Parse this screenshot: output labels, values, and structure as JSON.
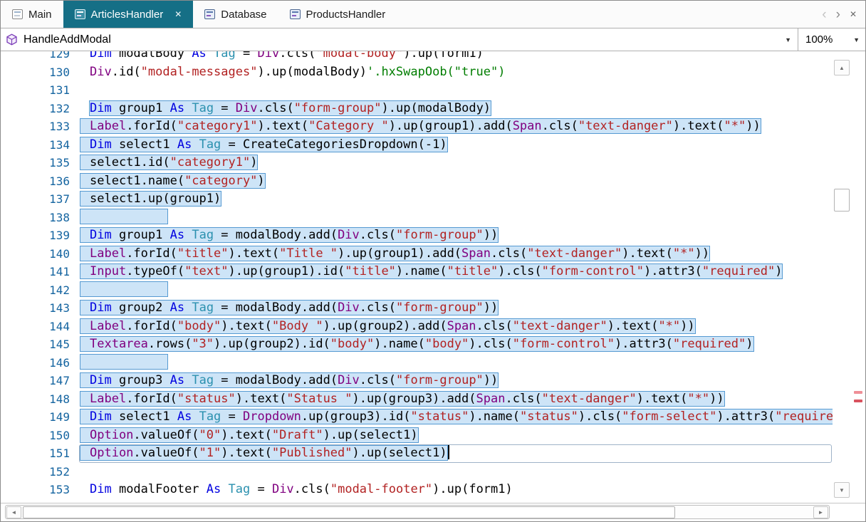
{
  "tabbar": {
    "tabs": [
      {
        "label": "Main",
        "icon": "form-module-icon",
        "active": false,
        "closable": false
      },
      {
        "label": "ArticlesHandler",
        "icon": "code-module-icon",
        "active": true,
        "closable": true
      },
      {
        "label": "Database",
        "icon": "code-module-icon",
        "active": false,
        "closable": false
      },
      {
        "label": "ProductsHandler",
        "icon": "code-module-icon",
        "active": false,
        "closable": false
      }
    ]
  },
  "navigator": {
    "selected_sub": "HandleAddModal",
    "zoom": "100%"
  },
  "icons": {
    "dropdown": "▼",
    "tab_back": "‹",
    "tab_forward": "›",
    "tab_close": "✕",
    "scroll_up": "▲",
    "scroll_down": "▼",
    "scroll_left": "◄",
    "scroll_right": "►"
  },
  "colors": {
    "active_tab": "#156f86",
    "keyword": "#0000e0",
    "type": "#2b91af",
    "tag_object": "#800080",
    "string": "#b22222",
    "comment": "#007d00",
    "line_number": "#1464a0",
    "selection_fill": "#cde4f7",
    "selection_border": "#569ad2",
    "error_marker": "#d9525e"
  },
  "editor": {
    "lines": [
      {
        "num": 129,
        "sel": "none",
        "tokens": [
          [
            "k",
            "Dim"
          ],
          [
            "p",
            " modalBody "
          ],
          [
            "k",
            "As"
          ],
          [
            "p",
            " "
          ],
          [
            "t",
            "Tag"
          ],
          [
            "p",
            " = "
          ],
          [
            "o",
            "Div"
          ],
          [
            "p",
            ".cls("
          ],
          [
            "s",
            "\"modal-body\""
          ],
          [
            "p",
            ").up(form1)"
          ]
        ]
      },
      {
        "num": 130,
        "sel": "none",
        "tokens": [
          [
            "o",
            "Div"
          ],
          [
            "p",
            ".id("
          ],
          [
            "s",
            "\"modal-messages\""
          ],
          [
            "p",
            ").up(modalBody)"
          ],
          [
            "c",
            "'.hxSwapOob(\"true\")"
          ]
        ]
      },
      {
        "num": 131,
        "sel": "none",
        "tokens": []
      },
      {
        "num": 132,
        "sel": "text",
        "tokens": [
          [
            "k",
            "Dim"
          ],
          [
            "p",
            " group1 "
          ],
          [
            "k",
            "As"
          ],
          [
            "p",
            " "
          ],
          [
            "t",
            "Tag"
          ],
          [
            "p",
            " = "
          ],
          [
            "o",
            "Div"
          ],
          [
            "p",
            ".cls("
          ],
          [
            "s",
            "\"form-group\""
          ],
          [
            "p",
            ").up(modalBody)"
          ]
        ]
      },
      {
        "num": 133,
        "sel": "line",
        "tokens": [
          [
            "o",
            "Label"
          ],
          [
            "p",
            ".forId("
          ],
          [
            "s",
            "\"category1\""
          ],
          [
            "p",
            ").text("
          ],
          [
            "s",
            "\"Category \""
          ],
          [
            "p",
            ").up(group1).add("
          ],
          [
            "o",
            "Span"
          ],
          [
            "p",
            ".cls("
          ],
          [
            "s",
            "\"text-danger\""
          ],
          [
            "p",
            ").text("
          ],
          [
            "s",
            "\"*\""
          ],
          [
            "p",
            "))"
          ]
        ]
      },
      {
        "num": 134,
        "sel": "line",
        "tokens": [
          [
            "k",
            "Dim"
          ],
          [
            "p",
            " select1 "
          ],
          [
            "k",
            "As"
          ],
          [
            "p",
            " "
          ],
          [
            "t",
            "Tag"
          ],
          [
            "p",
            " = CreateCategoriesDropdown(-1)"
          ]
        ]
      },
      {
        "num": 135,
        "sel": "line",
        "tokens": [
          [
            "p",
            "select1.id("
          ],
          [
            "s",
            "\"category1\""
          ],
          [
            "p",
            ")"
          ]
        ]
      },
      {
        "num": 136,
        "sel": "line",
        "tokens": [
          [
            "p",
            "select1.name("
          ],
          [
            "s",
            "\"category\""
          ],
          [
            "p",
            ")"
          ]
        ]
      },
      {
        "num": 137,
        "sel": "line",
        "tokens": [
          [
            "p",
            "select1.up(group1)"
          ]
        ]
      },
      {
        "num": 138,
        "sel": "empty",
        "tokens": []
      },
      {
        "num": 139,
        "sel": "line",
        "tokens": [
          [
            "k",
            "Dim"
          ],
          [
            "p",
            " group1 "
          ],
          [
            "k",
            "As"
          ],
          [
            "p",
            " "
          ],
          [
            "t",
            "Tag"
          ],
          [
            "p",
            " = modalBody.add("
          ],
          [
            "o",
            "Div"
          ],
          [
            "p",
            ".cls("
          ],
          [
            "s",
            "\"form-group\""
          ],
          [
            "p",
            "))"
          ]
        ]
      },
      {
        "num": 140,
        "sel": "line",
        "tokens": [
          [
            "o",
            "Label"
          ],
          [
            "p",
            ".forId("
          ],
          [
            "s",
            "\"title\""
          ],
          [
            "p",
            ").text("
          ],
          [
            "s",
            "\"Title \""
          ],
          [
            "p",
            ").up(group1).add("
          ],
          [
            "o",
            "Span"
          ],
          [
            "p",
            ".cls("
          ],
          [
            "s",
            "\"text-danger\""
          ],
          [
            "p",
            ").text("
          ],
          [
            "s",
            "\"*\""
          ],
          [
            "p",
            "))"
          ]
        ]
      },
      {
        "num": 141,
        "sel": "line",
        "tokens": [
          [
            "o",
            "Input"
          ],
          [
            "p",
            ".typeOf("
          ],
          [
            "s",
            "\"text\""
          ],
          [
            "p",
            ").up(group1).id("
          ],
          [
            "s",
            "\"title\""
          ],
          [
            "p",
            ").name("
          ],
          [
            "s",
            "\"title\""
          ],
          [
            "p",
            ").cls("
          ],
          [
            "s",
            "\"form-control\""
          ],
          [
            "p",
            ").attr3("
          ],
          [
            "s",
            "\"required\""
          ],
          [
            "p",
            ")"
          ]
        ]
      },
      {
        "num": 142,
        "sel": "empty",
        "tokens": []
      },
      {
        "num": 143,
        "sel": "line",
        "tokens": [
          [
            "k",
            "Dim"
          ],
          [
            "p",
            " group2 "
          ],
          [
            "k",
            "As"
          ],
          [
            "p",
            " "
          ],
          [
            "t",
            "Tag"
          ],
          [
            "p",
            " = modalBody.add("
          ],
          [
            "o",
            "Div"
          ],
          [
            "p",
            ".cls("
          ],
          [
            "s",
            "\"form-group\""
          ],
          [
            "p",
            "))"
          ]
        ]
      },
      {
        "num": 144,
        "sel": "line",
        "tokens": [
          [
            "o",
            "Label"
          ],
          [
            "p",
            ".forId("
          ],
          [
            "s",
            "\"body\""
          ],
          [
            "p",
            ").text("
          ],
          [
            "s",
            "\"Body \""
          ],
          [
            "p",
            ").up(group2).add("
          ],
          [
            "o",
            "Span"
          ],
          [
            "p",
            ".cls("
          ],
          [
            "s",
            "\"text-danger\""
          ],
          [
            "p",
            ").text("
          ],
          [
            "s",
            "\"*\""
          ],
          [
            "p",
            "))"
          ]
        ]
      },
      {
        "num": 145,
        "sel": "line",
        "tokens": [
          [
            "o",
            "Textarea"
          ],
          [
            "p",
            ".rows("
          ],
          [
            "s",
            "\"3\""
          ],
          [
            "p",
            ").up(group2).id("
          ],
          [
            "s",
            "\"body\""
          ],
          [
            "p",
            ").name("
          ],
          [
            "s",
            "\"body\""
          ],
          [
            "p",
            ").cls("
          ],
          [
            "s",
            "\"form-control\""
          ],
          [
            "p",
            ").attr3("
          ],
          [
            "s",
            "\"required\""
          ],
          [
            "p",
            ")"
          ]
        ]
      },
      {
        "num": 146,
        "sel": "empty",
        "tokens": []
      },
      {
        "num": 147,
        "sel": "line",
        "tokens": [
          [
            "k",
            "Dim"
          ],
          [
            "p",
            " group3 "
          ],
          [
            "k",
            "As"
          ],
          [
            "p",
            " "
          ],
          [
            "t",
            "Tag"
          ],
          [
            "p",
            " = modalBody.add("
          ],
          [
            "o",
            "Div"
          ],
          [
            "p",
            ".cls("
          ],
          [
            "s",
            "\"form-group\""
          ],
          [
            "p",
            "))"
          ]
        ]
      },
      {
        "num": 148,
        "sel": "line",
        "tokens": [
          [
            "o",
            "Label"
          ],
          [
            "p",
            ".forId("
          ],
          [
            "s",
            "\"status\""
          ],
          [
            "p",
            ").text("
          ],
          [
            "s",
            "\"Status \""
          ],
          [
            "p",
            ").up(group3).add("
          ],
          [
            "o",
            "Span"
          ],
          [
            "p",
            ".cls("
          ],
          [
            "s",
            "\"text-danger\""
          ],
          [
            "p",
            ").text("
          ],
          [
            "s",
            "\"*\""
          ],
          [
            "p",
            "))"
          ]
        ]
      },
      {
        "num": 149,
        "sel": "line",
        "tokens": [
          [
            "k",
            "Dim"
          ],
          [
            "p",
            " select1 "
          ],
          [
            "k",
            "As"
          ],
          [
            "p",
            " "
          ],
          [
            "t",
            "Tag"
          ],
          [
            "p",
            " = "
          ],
          [
            "o",
            "Dropdown"
          ],
          [
            "p",
            ".up(group3).id("
          ],
          [
            "s",
            "\"status\""
          ],
          [
            "p",
            ").name("
          ],
          [
            "s",
            "\"status\""
          ],
          [
            "p",
            ").cls("
          ],
          [
            "s",
            "\"form-select\""
          ],
          [
            "p",
            ").attr3("
          ],
          [
            "s",
            "\"required\""
          ],
          [
            "p",
            ")"
          ]
        ]
      },
      {
        "num": 150,
        "sel": "line",
        "tokens": [
          [
            "o",
            "Option"
          ],
          [
            "p",
            ".valueOf("
          ],
          [
            "s",
            "\"0\""
          ],
          [
            "p",
            ").text("
          ],
          [
            "s",
            "\"Draft\""
          ],
          [
            "p",
            ").up(select1)"
          ]
        ]
      },
      {
        "num": 151,
        "sel": "line",
        "caret": true,
        "current": true,
        "tokens": [
          [
            "o",
            "Option"
          ],
          [
            "p",
            ".valueOf("
          ],
          [
            "s",
            "\"1\""
          ],
          [
            "p",
            ").text("
          ],
          [
            "s",
            "\"Published\""
          ],
          [
            "p",
            ").up(select1)"
          ]
        ]
      },
      {
        "num": 152,
        "sel": "none",
        "tokens": []
      },
      {
        "num": 153,
        "sel": "none",
        "tokens": [
          [
            "k",
            "Dim"
          ],
          [
            "p",
            " modalFooter "
          ],
          [
            "k",
            "As"
          ],
          [
            "p",
            " "
          ],
          [
            "t",
            "Tag"
          ],
          [
            "p",
            " = "
          ],
          [
            "o",
            "Div"
          ],
          [
            "p",
            ".cls("
          ],
          [
            "s",
            "\"modal-footer\""
          ],
          [
            "p",
            ").up(form1)"
          ]
        ]
      }
    ]
  }
}
